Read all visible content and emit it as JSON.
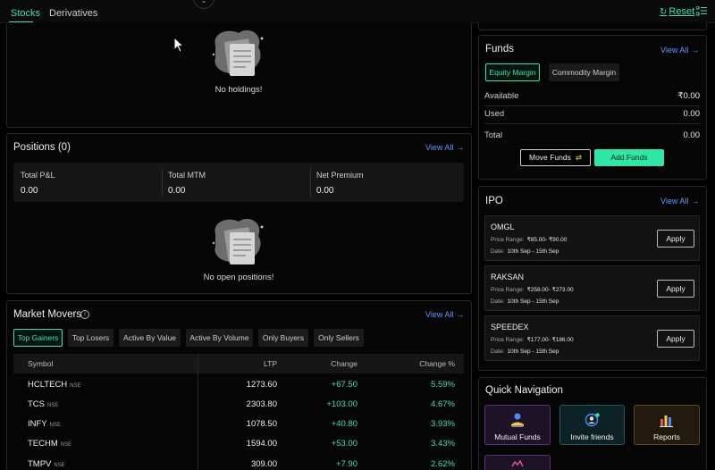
{
  "tabs": {
    "stocks": "Stocks",
    "derivatives": "Derivatives"
  },
  "toolbar": {
    "reset_label": "Reset"
  },
  "holdings": {
    "empty_text": "No holdings!"
  },
  "positions": {
    "title": "Positions (0)",
    "view_all": "View All",
    "summary": [
      {
        "label": "Total P&L",
        "value": "0.00"
      },
      {
        "label": "Total MTM",
        "value": "0.00"
      },
      {
        "label": "Net Premium",
        "value": "0.00"
      }
    ],
    "empty_text": "No open positions!"
  },
  "market_movers": {
    "title": "Market Movers",
    "view_all": "View All",
    "filters": [
      "Top Gainers",
      "Top Losers",
      "Active By Value",
      "Active By Volume",
      "Only Buyers",
      "Only Sellers"
    ],
    "active_filter": "Top Gainers",
    "columns": {
      "symbol": "Symbol",
      "ltp": "LTP",
      "change": "Change",
      "change_pct": "Change %"
    },
    "rows": [
      {
        "symbol": "HCLTECH",
        "exchange": "NSE",
        "ltp": "1273.60",
        "change": "+67.50",
        "change_pct": "5.59%"
      },
      {
        "symbol": "TCS",
        "exchange": "NSE",
        "ltp": "2303.80",
        "change": "+103.00",
        "change_pct": "4.67%"
      },
      {
        "symbol": "INFY",
        "exchange": "NSE",
        "ltp": "1078.50",
        "change": "+40.80",
        "change_pct": "3.93%"
      },
      {
        "symbol": "TECHM",
        "exchange": "NSE",
        "ltp": "1594.00",
        "change": "+53.00",
        "change_pct": "3.43%"
      },
      {
        "symbol": "TMPV",
        "exchange": "NSE",
        "ltp": "309.00",
        "change": "+7.90",
        "change_pct": "2.62%"
      }
    ]
  },
  "funds": {
    "title": "Funds",
    "view_all": "View All",
    "segments": {
      "equity": "Equity Margin",
      "commodity": "Commodity Margin"
    },
    "rows": [
      {
        "label": "Available",
        "value": "₹0.00"
      },
      {
        "label": "Used",
        "value": "0.00"
      },
      {
        "label": "Total",
        "value": "0.00"
      }
    ],
    "move_funds": "Move Funds",
    "add_funds": "Add Funds"
  },
  "ipo": {
    "title": "IPO",
    "view_all": "View All",
    "price_label": "Price Range:",
    "date_label": "Date:",
    "apply_label": "Apply",
    "items": [
      {
        "name": "OMGL",
        "price_range": "₹85.00- ₹90.00",
        "date": "10th Sep - 15th Sep"
      },
      {
        "name": "RAKSAN",
        "price_range": "₹258.00- ₹273.00",
        "date": "10th Sep - 15th Sep"
      },
      {
        "name": "SPEEDEX",
        "price_range": "₹177.00- ₹186.00",
        "date": "10th Sep - 15th Sep"
      }
    ]
  },
  "quick_nav": {
    "title": "Quick Navigation",
    "items": [
      {
        "label": "Mutual Funds",
        "icon": "mutual-funds-icon"
      },
      {
        "label": "Invite friends",
        "icon": "invite-friends-icon"
      },
      {
        "label": "Reports",
        "icon": "reports-icon"
      }
    ]
  },
  "colors": {
    "accent": "#2ee6a6",
    "link": "#5b9bff",
    "background": "#000000"
  }
}
